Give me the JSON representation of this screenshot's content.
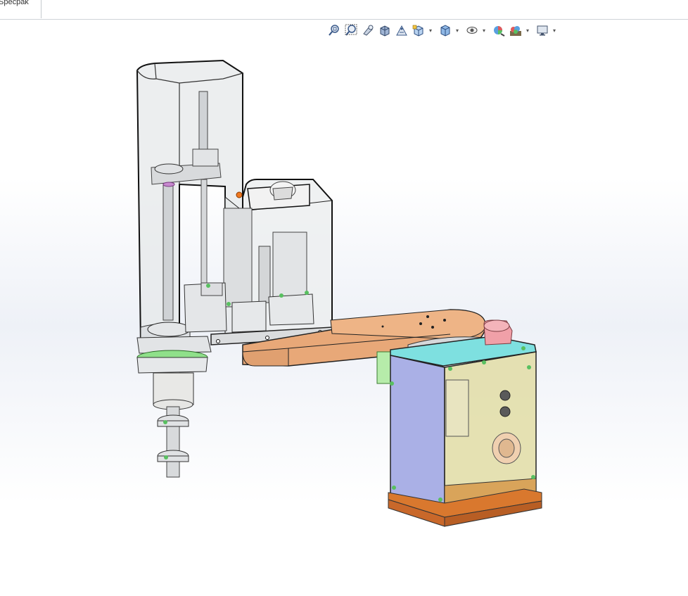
{
  "tab": {
    "label": "Specpak"
  },
  "toolbar": {
    "items": [
      {
        "icon": "zoom-to-fit-icon"
      },
      {
        "icon": "zoom-to-area-icon"
      },
      {
        "icon": "previous-view-icon"
      },
      {
        "icon": "section-view-icon"
      },
      {
        "icon": "dynamic-annotation-icon"
      },
      {
        "icon": "view-orientation-icon",
        "dropdown": true
      },
      {
        "icon": "display-style-icon",
        "dropdown": true
      },
      {
        "icon": "hide-show-items-icon",
        "dropdown": true
      },
      {
        "icon": "edit-appearance-icon"
      },
      {
        "icon": "apply-scene-icon",
        "dropdown": true
      },
      {
        "icon": "view-settings-icon",
        "dropdown": true
      }
    ]
  },
  "model": {
    "subject": "scara-robot-assembly"
  },
  "colors": {
    "arm": "#e8a878",
    "base_side": "#aab0e6",
    "base_inner": "#e2deaa",
    "base_top": "#7ee0e0",
    "base_plate": "#d9782e",
    "green_ring": "#8fe08a",
    "accent_orange": "#f07820"
  }
}
